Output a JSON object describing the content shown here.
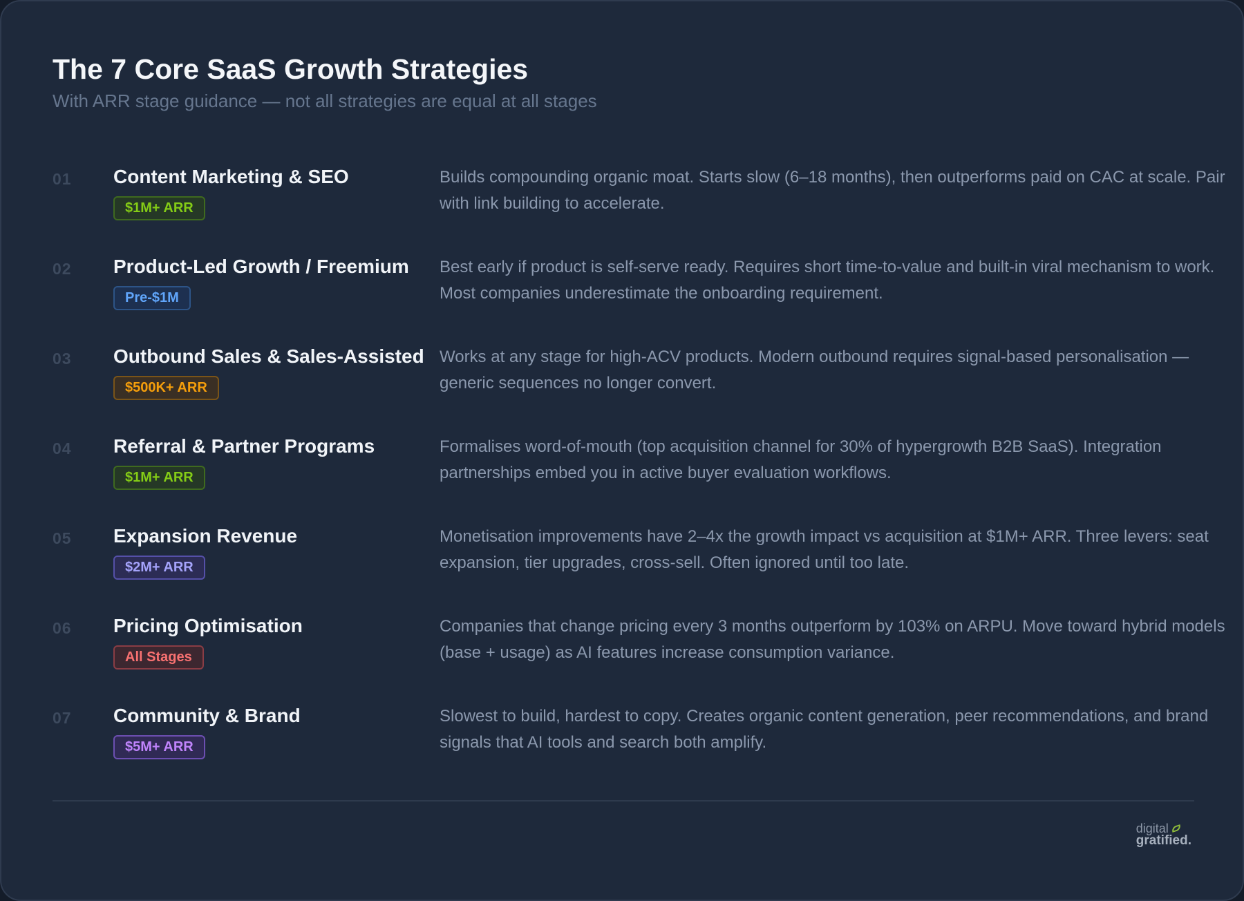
{
  "header": {
    "title": "The 7 Core SaaS Growth Strategies",
    "subtitle": "With ARR stage guidance — not all strategies are equal at all stages"
  },
  "badge_colors": {
    "green": "#84cc16",
    "blue": "#60a5fa",
    "orange": "#f59e0b",
    "indigo": "#a5a3fb",
    "red": "#f87171",
    "violet": "#c084fc"
  },
  "strategies": [
    {
      "num": "01",
      "name": "Content Marketing & SEO",
      "stage": "$1M+ ARR",
      "stage_color": "green",
      "description": "Builds compounding organic moat. Starts slow (6–18 months), then outperforms paid on CAC at scale. Pair with link building to accelerate."
    },
    {
      "num": "02",
      "name": "Product-Led Growth / Freemium",
      "stage": "Pre-$1M",
      "stage_color": "blue",
      "description": "Best early if product is self-serve ready. Requires short time-to-value and built-in viral mechanism to work. Most companies underestimate the onboarding requirement."
    },
    {
      "num": "03",
      "name": "Outbound Sales & Sales-Assisted",
      "stage": "$500K+ ARR",
      "stage_color": "orange",
      "description": "Works at any stage for high-ACV products. Modern outbound requires signal-based personalisation — generic sequences no longer convert."
    },
    {
      "num": "04",
      "name": "Referral & Partner Programs",
      "stage": "$1M+ ARR",
      "stage_color": "green",
      "description": "Formalises word-of-mouth (top acquisition channel for 30% of hypergrowth B2B SaaS). Integration partnerships embed you in active buyer evaluation workflows."
    },
    {
      "num": "05",
      "name": "Expansion Revenue",
      "stage": "$2M+ ARR",
      "stage_color": "indigo",
      "description": "Monetisation improvements have 2–4x the growth impact vs acquisition at $1M+ ARR. Three levers: seat expansion, tier upgrades, cross-sell. Often ignored until too late."
    },
    {
      "num": "06",
      "name": "Pricing Optimisation",
      "stage": "All Stages",
      "stage_color": "red",
      "description": "Companies that change pricing every 3 months outperform by 103% on ARPU. Move toward hybrid models (base + usage) as AI features increase consumption variance."
    },
    {
      "num": "07",
      "name": "Community & Brand",
      "stage": "$5M+ ARR",
      "stage_color": "violet",
      "description": "Slowest to build, hardest to copy. Creates organic content generation, peer recommendations, and brand signals that AI tools and search both amplify."
    }
  ],
  "footer": {
    "logo_line1": "digital",
    "logo_line2": "gratified."
  }
}
